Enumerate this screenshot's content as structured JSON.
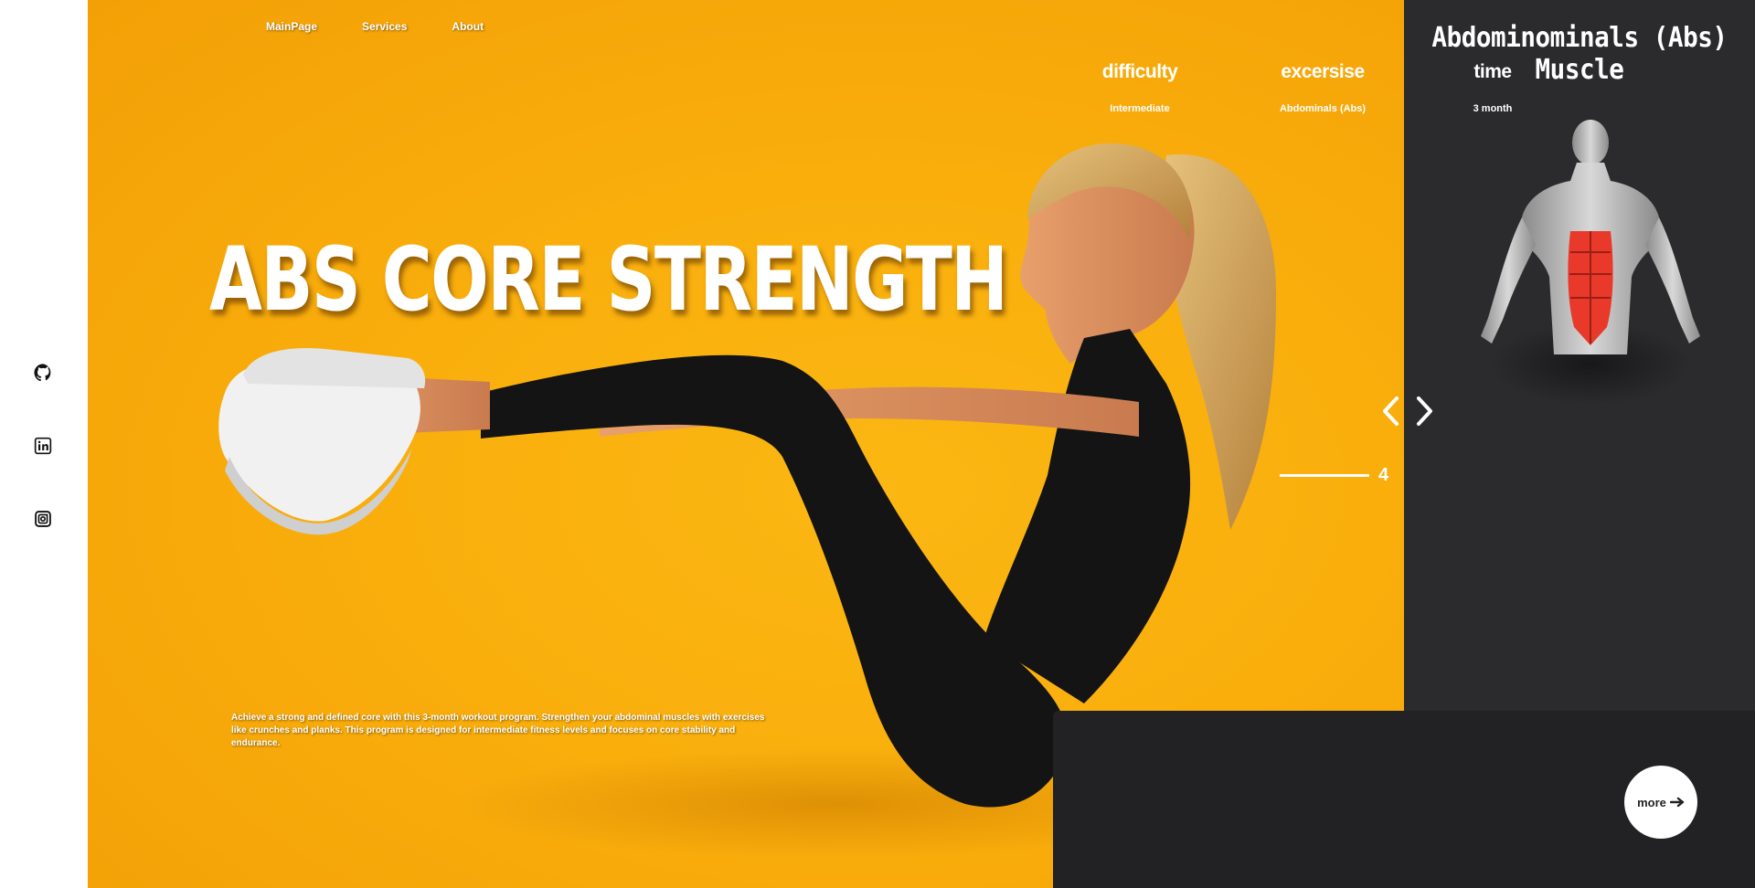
{
  "nav": {
    "items": [
      "MainPage",
      "Services",
      "About"
    ]
  },
  "hero": {
    "title": "ABS CORE STRENGTH",
    "description": "Achieve a strong and defined core with this 3-month workout program. Strengthen your abdominal muscles with exercises like crunches and planks. This program is designed for intermediate fitness levels and focuses on core stability and endurance."
  },
  "panel": {
    "title": "Abdominominals (Abs) Muscle"
  },
  "slider": {
    "index": "4"
  },
  "details": {
    "difficulty_label": "difficulty",
    "difficulty_value": "Intermediate",
    "exercise_label": "excersise",
    "exercise_value": "Abdominals (Abs)",
    "time_label": "time",
    "time_value": "3 month",
    "more_label": "more"
  },
  "social": {
    "icons": [
      "github-icon",
      "linkedin-icon",
      "instagram-icon"
    ]
  },
  "colors": {
    "hero_background": "#f9ae0c",
    "panel_background": "#2b2a2d",
    "info_background": "#222124",
    "text": "#ffffff"
  }
}
